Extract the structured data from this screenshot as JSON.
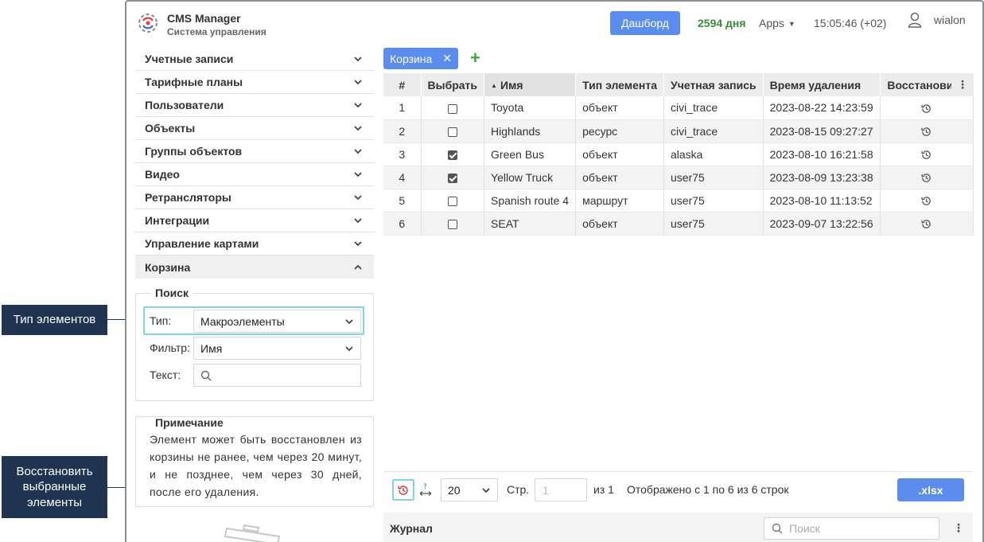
{
  "annotations": {
    "element_type": "Тип элементов",
    "restore_selected": "Восстановить выбранные элементы"
  },
  "header": {
    "title": "CMS Manager",
    "subtitle": "Система управления",
    "dashboard_label": "Дашборд",
    "days": "2594 дня",
    "apps_label": "Apps",
    "time": "15:05:46 (+02)",
    "username": "wialon",
    "days_color": "#3a8a3a",
    "accent_color": "#5b8def"
  },
  "sidebar": {
    "items": [
      {
        "label": "Учетные записи",
        "icon": "chevron-down-icon"
      },
      {
        "label": "Тарифные планы",
        "icon": "chevron-down-icon"
      },
      {
        "label": "Пользователи",
        "icon": "chevron-down-icon"
      },
      {
        "label": "Объекты",
        "icon": "chevron-down-icon"
      },
      {
        "label": "Группы объектов",
        "icon": "chevron-down-icon"
      },
      {
        "label": "Видео",
        "icon": "chevron-down-icon"
      },
      {
        "label": "Ретрансляторы",
        "icon": "chevron-down-icon"
      },
      {
        "label": "Интеграции",
        "icon": "chevron-down-icon"
      },
      {
        "label": "Управление картами",
        "icon": "chevron-down-icon"
      },
      {
        "label": "Корзина",
        "icon": "chevron-up-icon"
      }
    ],
    "search": {
      "legend": "Поиск",
      "type_label": "Тип:",
      "type_value": "Макроэлементы",
      "filter_label": "Фильтр:",
      "filter_value": "Имя",
      "text_label": "Текст:"
    },
    "note": {
      "legend": "Примечание",
      "text": "Элемент может быть восстановлен из корзины не ранее, чем через 20 минут, и не позднее, чем через 30 дней, после его удаления."
    }
  },
  "main": {
    "tab_label": "Корзина",
    "table": {
      "headers": [
        "#",
        "Выбрать",
        "Имя",
        "Тип элемента",
        "Учетная запись",
        "Время удаления",
        "Восстановить"
      ],
      "rows": [
        {
          "num": "1",
          "checked": false,
          "name": "Toyota",
          "type": "объект",
          "account": "civi_trace",
          "deleted": "2023-08-22 14:23:59"
        },
        {
          "num": "2",
          "checked": false,
          "name": "Highlands",
          "type": "ресурс",
          "account": "civi_trace",
          "deleted": "2023-08-15 09:27:27"
        },
        {
          "num": "3",
          "checked": true,
          "name": "Green Bus",
          "type": "объект",
          "account": "alaska",
          "deleted": "2023-08-10 16:21:58"
        },
        {
          "num": "4",
          "checked": true,
          "name": "Yellow Truck",
          "type": "объект",
          "account": "user75",
          "deleted": "2023-08-09 13:23:38"
        },
        {
          "num": "5",
          "checked": false,
          "name": "Spanish route 4",
          "type": "маршрут",
          "account": "user75",
          "deleted": "2023-08-10 11:13:52"
        },
        {
          "num": "6",
          "checked": false,
          "name": "SEAT",
          "type": "объект",
          "account": "user75",
          "deleted": "2023-09-07 13:22:56"
        }
      ]
    },
    "pager": {
      "page_size": "20",
      "page_label": "Стр.",
      "page_placeholder": "1",
      "of_label": "из 1",
      "summary": "Отображено с 1 по 6 из 6 строк",
      "export_label": ".xlsx"
    },
    "journal": {
      "title": "Журнал",
      "search_placeholder": "Поиск"
    }
  }
}
